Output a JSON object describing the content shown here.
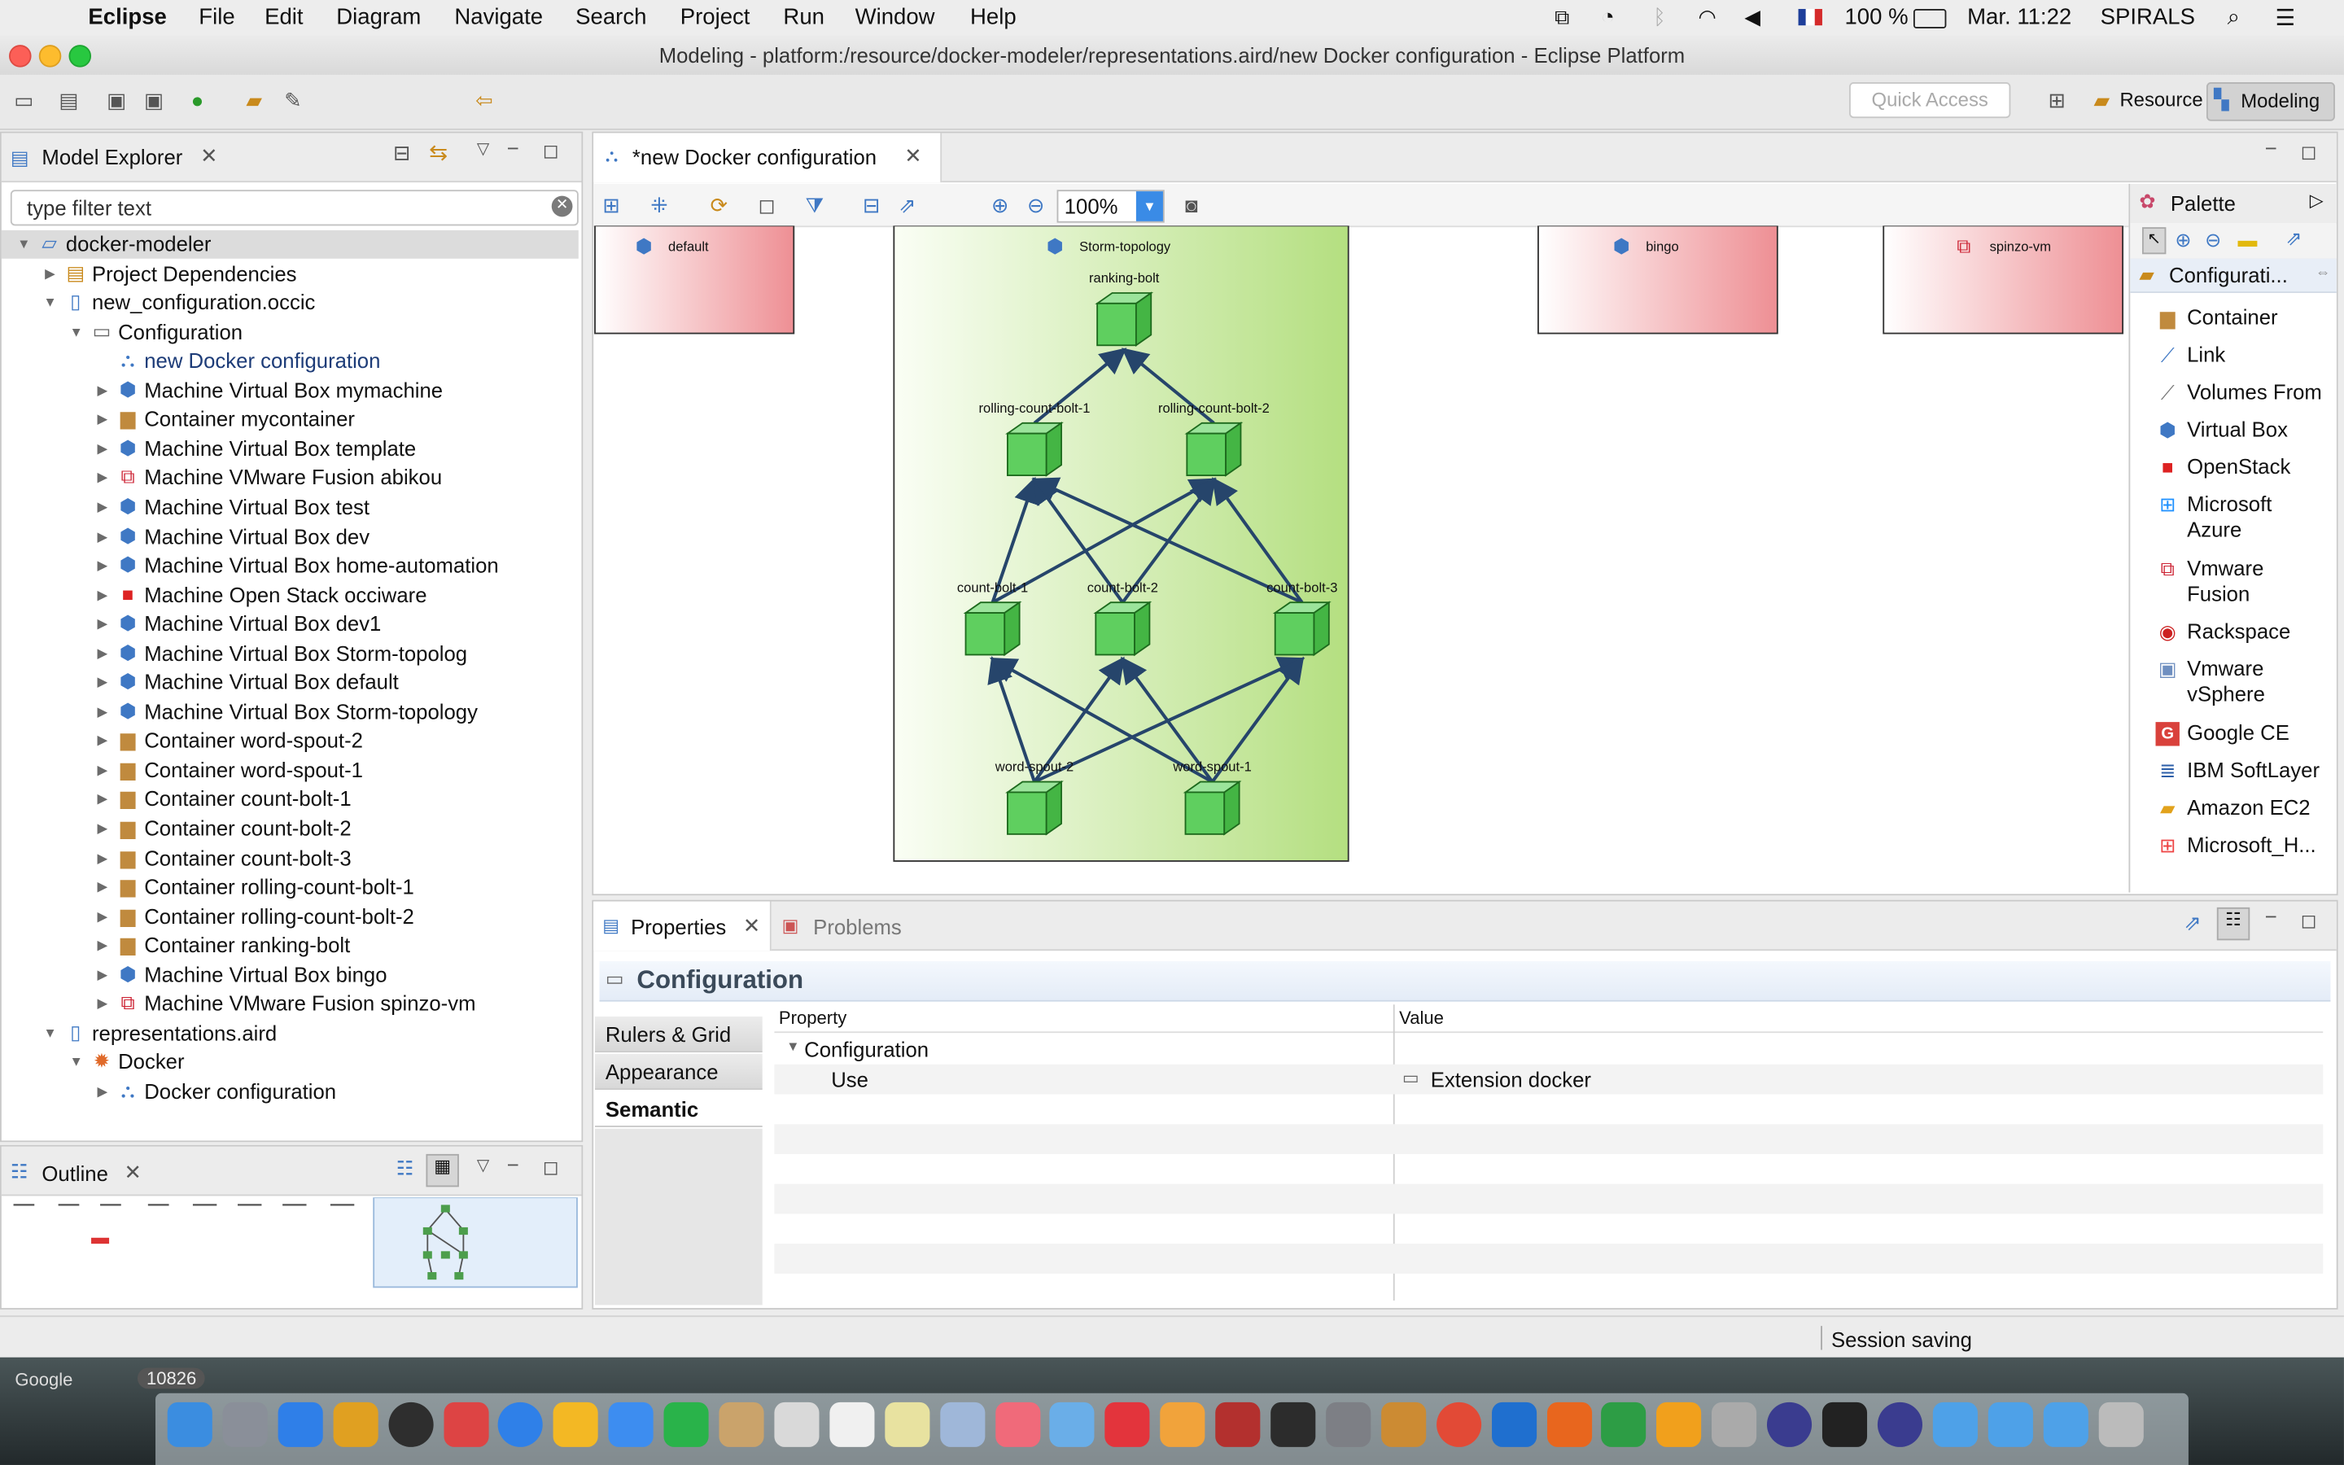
{
  "menu_bar": {
    "app_name": "Eclipse",
    "items": [
      "File",
      "Edit",
      "Diagram",
      "Navigate",
      "Search",
      "Project",
      "Run",
      "Window",
      "Help"
    ],
    "battery": "100 %",
    "clock": "Mar. 11:22",
    "user": "SPIRALS"
  },
  "window": {
    "title": "Modeling - platform:/resource/docker-modeler/representations.aird/new Docker configuration - Eclipse Platform"
  },
  "toolbar": {
    "quick_access_placeholder": "Quick Access",
    "perspectives": [
      "Resource",
      "Modeling"
    ]
  },
  "model_explorer": {
    "title": "Model Explorer",
    "filter_placeholder": "type filter text",
    "tree": [
      {
        "label": "docker-modeler",
        "icon": "project-icon",
        "level": 0,
        "expanded": true
      },
      {
        "label": "Project Dependencies",
        "icon": "library-icon",
        "level": 1,
        "expanded": false
      },
      {
        "label": "new_configuration.occic",
        "icon": "file-icon",
        "level": 1,
        "expanded": true
      },
      {
        "label": "Configuration",
        "icon": "folder-icon",
        "level": 2,
        "expanded": true
      },
      {
        "label": "new Docker configuration",
        "icon": "diagram-icon",
        "level": 3,
        "expanded": null,
        "highlight": true
      },
      {
        "label": "Machine Virtual Box mymachine",
        "icon": "virtualbox-icon",
        "level": 3,
        "expanded": false
      },
      {
        "label": "Container mycontainer",
        "icon": "container-icon",
        "level": 3,
        "expanded": false
      },
      {
        "label": "Machine Virtual Box template",
        "icon": "virtualbox-icon",
        "level": 3,
        "expanded": false
      },
      {
        "label": "Machine VMware Fusion abikou",
        "icon": "vmware-icon",
        "level": 3,
        "expanded": false
      },
      {
        "label": "Machine Virtual Box test",
        "icon": "virtualbox-icon",
        "level": 3,
        "expanded": false
      },
      {
        "label": "Machine Virtual Box dev",
        "icon": "virtualbox-icon",
        "level": 3,
        "expanded": false
      },
      {
        "label": "Machine Virtual Box home-automation",
        "icon": "virtualbox-icon",
        "level": 3,
        "expanded": false
      },
      {
        "label": "Machine Open Stack occiware",
        "icon": "openstack-icon",
        "level": 3,
        "expanded": false
      },
      {
        "label": "Machine Virtual Box dev1",
        "icon": "virtualbox-icon",
        "level": 3,
        "expanded": false
      },
      {
        "label": "Machine Virtual Box Storm-topolog",
        "icon": "virtualbox-icon",
        "level": 3,
        "expanded": false
      },
      {
        "label": "Machine Virtual Box default",
        "icon": "virtualbox-icon",
        "level": 3,
        "expanded": false
      },
      {
        "label": "Machine Virtual Box Storm-topology",
        "icon": "virtualbox-icon",
        "level": 3,
        "expanded": false
      },
      {
        "label": "Container word-spout-2",
        "icon": "container-icon",
        "level": 3,
        "expanded": false
      },
      {
        "label": "Container word-spout-1",
        "icon": "container-icon",
        "level": 3,
        "expanded": false
      },
      {
        "label": "Container count-bolt-1",
        "icon": "container-icon",
        "level": 3,
        "expanded": false
      },
      {
        "label": "Container count-bolt-2",
        "icon": "container-icon",
        "level": 3,
        "expanded": false
      },
      {
        "label": "Container count-bolt-3",
        "icon": "container-icon",
        "level": 3,
        "expanded": false
      },
      {
        "label": "Container rolling-count-bolt-1",
        "icon": "container-icon",
        "level": 3,
        "expanded": false
      },
      {
        "label": "Container rolling-count-bolt-2",
        "icon": "container-icon",
        "level": 3,
        "expanded": false
      },
      {
        "label": "Container ranking-bolt",
        "icon": "container-icon",
        "level": 3,
        "expanded": false
      },
      {
        "label": "Machine Virtual Box bingo",
        "icon": "virtualbox-icon",
        "level": 3,
        "expanded": false
      },
      {
        "label": "Machine VMware Fusion spinzo-vm",
        "icon": "vmware-icon",
        "level": 3,
        "expanded": false
      },
      {
        "label": "representations.aird",
        "icon": "aird-icon",
        "level": 1,
        "expanded": true
      },
      {
        "label": "Docker",
        "icon": "viewpoint-icon",
        "level": 2,
        "expanded": true
      },
      {
        "label": "Docker configuration",
        "icon": "diagram-icon",
        "level": 3,
        "expanded": false
      }
    ]
  },
  "outline": {
    "title": "Outline"
  },
  "editor": {
    "tab_title": "*new Docker configuration",
    "zoom": "100%",
    "machines": [
      {
        "label": "default",
        "icon": "virtualbox-icon"
      },
      {
        "label": "Storm-topology",
        "icon": "virtualbox-icon"
      },
      {
        "label": "bingo",
        "icon": "virtualbox-icon"
      },
      {
        "label": "spinzo-vm",
        "icon": "vmware-icon"
      }
    ],
    "containers": [
      {
        "label": "ranking-bolt"
      },
      {
        "label": "rolling-count-bolt-1"
      },
      {
        "label": "rolling-count-bolt-2"
      },
      {
        "label": "count-bolt-1"
      },
      {
        "label": "count-bolt-2"
      },
      {
        "label": "count-bolt-3"
      },
      {
        "label": "word-spout-2"
      },
      {
        "label": "word-spout-1"
      }
    ],
    "links": [
      [
        "rolling-count-bolt-1",
        "ranking-bolt"
      ],
      [
        "rolling-count-bolt-2",
        "ranking-bolt"
      ],
      [
        "count-bolt-1",
        "rolling-count-bolt-1"
      ],
      [
        "count-bolt-1",
        "rolling-count-bolt-2"
      ],
      [
        "count-bolt-2",
        "rolling-count-bolt-1"
      ],
      [
        "count-bolt-2",
        "rolling-count-bolt-2"
      ],
      [
        "count-bolt-3",
        "rolling-count-bolt-1"
      ],
      [
        "count-bolt-3",
        "rolling-count-bolt-2"
      ],
      [
        "word-spout-2",
        "count-bolt-1"
      ],
      [
        "word-spout-2",
        "count-bolt-2"
      ],
      [
        "word-spout-2",
        "count-bolt-3"
      ],
      [
        "word-spout-1",
        "count-bolt-1"
      ],
      [
        "word-spout-1",
        "count-bolt-2"
      ],
      [
        "word-spout-1",
        "count-bolt-3"
      ]
    ]
  },
  "palette": {
    "title": "Palette",
    "group": "Configurati...",
    "items": [
      {
        "label": "Container",
        "icon": "container-icon"
      },
      {
        "label": "Link",
        "icon": "link-icon"
      },
      {
        "label": "Volumes From",
        "icon": "volumes-from-icon"
      },
      {
        "label": "Virtual Box",
        "icon": "virtualbox-icon"
      },
      {
        "label": "OpenStack",
        "icon": "openstack-icon"
      },
      {
        "label": "Microsoft\nAzure",
        "icon": "azure-icon"
      },
      {
        "label": "Vmware\nFusion",
        "icon": "vmware-icon"
      },
      {
        "label": "Rackspace",
        "icon": "rackspace-icon"
      },
      {
        "label": "Vmware\nvSphere",
        "icon": "vsphere-icon"
      },
      {
        "label": "Google CE",
        "icon": "google-icon"
      },
      {
        "label": "IBM SoftLayer",
        "icon": "ibm-icon"
      },
      {
        "label": "Amazon EC2",
        "icon": "amazon-icon"
      },
      {
        "label": "Microsoft_H...",
        "icon": "hyperv-icon"
      }
    ]
  },
  "properties": {
    "tabs": [
      "Properties",
      "Problems"
    ],
    "header": "Configuration",
    "side_tabs": [
      "Rulers & Grid",
      "Appearance",
      "Semantic"
    ],
    "columns": [
      "Property",
      "Value"
    ],
    "rows": [
      {
        "property": "Configuration",
        "value": "",
        "group": true
      },
      {
        "property": "Use",
        "value": "Extension docker",
        "group": false
      }
    ]
  },
  "status_bar": {
    "message": "Session saving"
  },
  "dock": {
    "partial_label": "Google",
    "partial_count": "10826"
  }
}
